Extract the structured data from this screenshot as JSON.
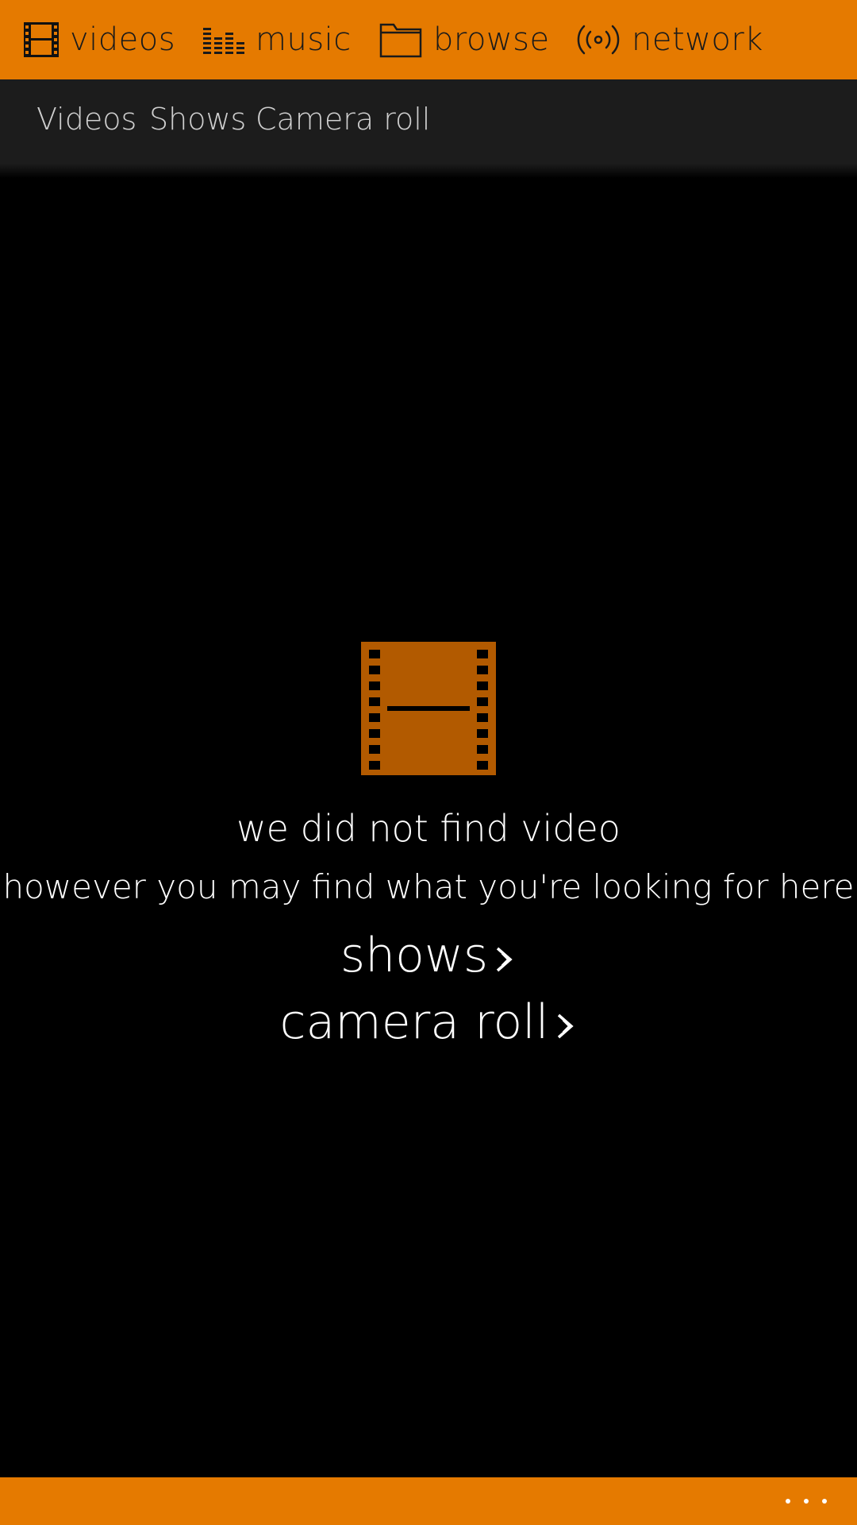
{
  "colors": {
    "accent": "#e57a00",
    "pivot_background": "#1c1c1c",
    "background": "#000000",
    "empty_icon_fill": "#b25a00"
  },
  "top_nav": {
    "items": [
      {
        "label": "videos",
        "icon": "film-icon"
      },
      {
        "label": "music",
        "icon": "equalizer-icon"
      },
      {
        "label": "browse",
        "icon": "folder-icon"
      },
      {
        "label": "network",
        "icon": "broadcast-icon"
      }
    ]
  },
  "pivot": {
    "items": [
      {
        "label": "Videos"
      },
      {
        "label": "Shows"
      },
      {
        "label": "Camera roll"
      }
    ]
  },
  "empty_state": {
    "icon": "film-icon",
    "title": "we did not find video",
    "subtitle": "however you may find what you're looking for here",
    "links": [
      {
        "label": "shows",
        "icon": "double-chevron-right-icon"
      },
      {
        "label": "camera roll",
        "icon": "double-chevron-right-icon"
      }
    ]
  },
  "app_bar": {
    "more_icon": "more-ellipsis-icon"
  }
}
